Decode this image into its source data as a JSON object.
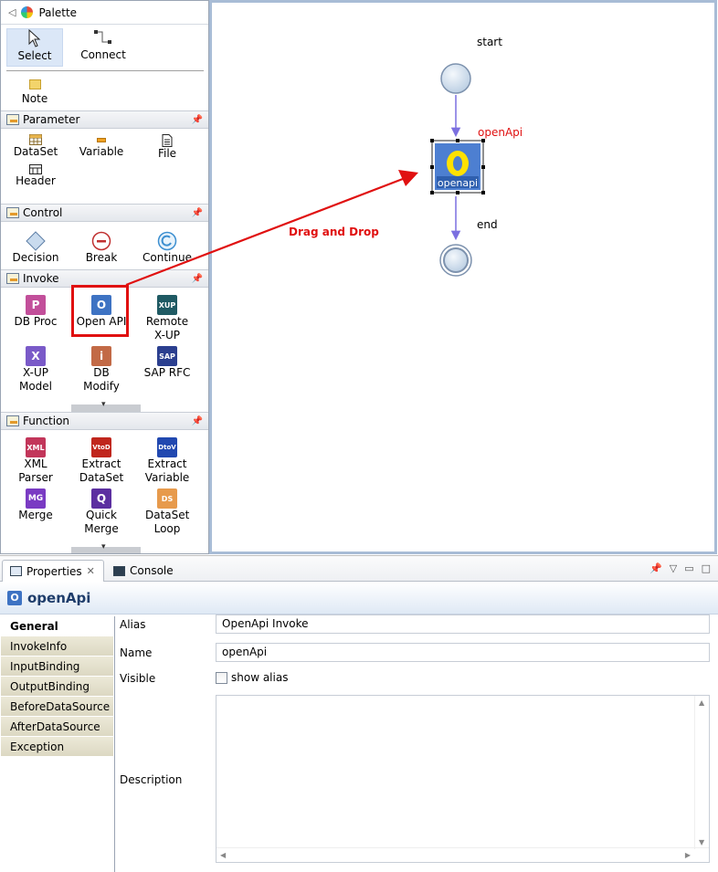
{
  "palette": {
    "title": "Palette",
    "tools": [
      {
        "label": "Select",
        "icon": "arrow-cursor-icon"
      },
      {
        "label": "Connect",
        "icon": "connection-icon"
      }
    ],
    "note_label": "Note",
    "drawers": {
      "parameter": {
        "title": "Parameter",
        "items": [
          "DataSet",
          "Variable",
          "File",
          "Header"
        ]
      },
      "control": {
        "title": "Control",
        "items": [
          "Decision",
          "Break",
          "Continue"
        ]
      },
      "invoke": {
        "title": "Invoke",
        "items": [
          "DB Proc",
          "Open API",
          "Remote X-UP",
          "X-UP Model",
          "DB Modify",
          "SAP RFC"
        ]
      },
      "function": {
        "title": "Function",
        "items": [
          "XML Parser",
          "Extract DataSet",
          "Extract Variable",
          "Merge",
          "Quick Merge",
          "DataSet Loop"
        ]
      }
    },
    "icon_text": {
      "dbproc": "P",
      "openapi": "O",
      "remote": "XUP",
      "xup": "X",
      "dbmodify": "i",
      "sap": "SAP",
      "xml": "XML",
      "vtod": "VtoD",
      "dtov": "DtoV",
      "mg": "MG",
      "q": "Q",
      "loop": "DS"
    }
  },
  "canvas": {
    "start_label": "start",
    "end_label": "end",
    "node_label": "openApi",
    "node_icon_letter": "O",
    "node_caption": "openapi",
    "annotation": "Drag and Drop",
    "colors": {
      "arrow_red": "#e01010",
      "flow_purple": "#7b6fe0",
      "node_blue": "#4d7fd1",
      "circle_fill": "#d6e2ef"
    }
  },
  "properties": {
    "tab_label": "Properties",
    "console_label": "Console",
    "object_name": "openApi",
    "object_icon": "O",
    "sections": [
      "General",
      "InvokeInfo",
      "InputBinding",
      "OutputBinding",
      "BeforeDataSource",
      "AfterDataSource",
      "Exception"
    ],
    "fields": {
      "alias_label": "Alias",
      "alias_value": "OpenApi Invoke",
      "name_label": "Name",
      "name_value": "openApi",
      "visible_label": "Visible",
      "show_alias_label": "show alias",
      "description_label": "Description"
    }
  }
}
